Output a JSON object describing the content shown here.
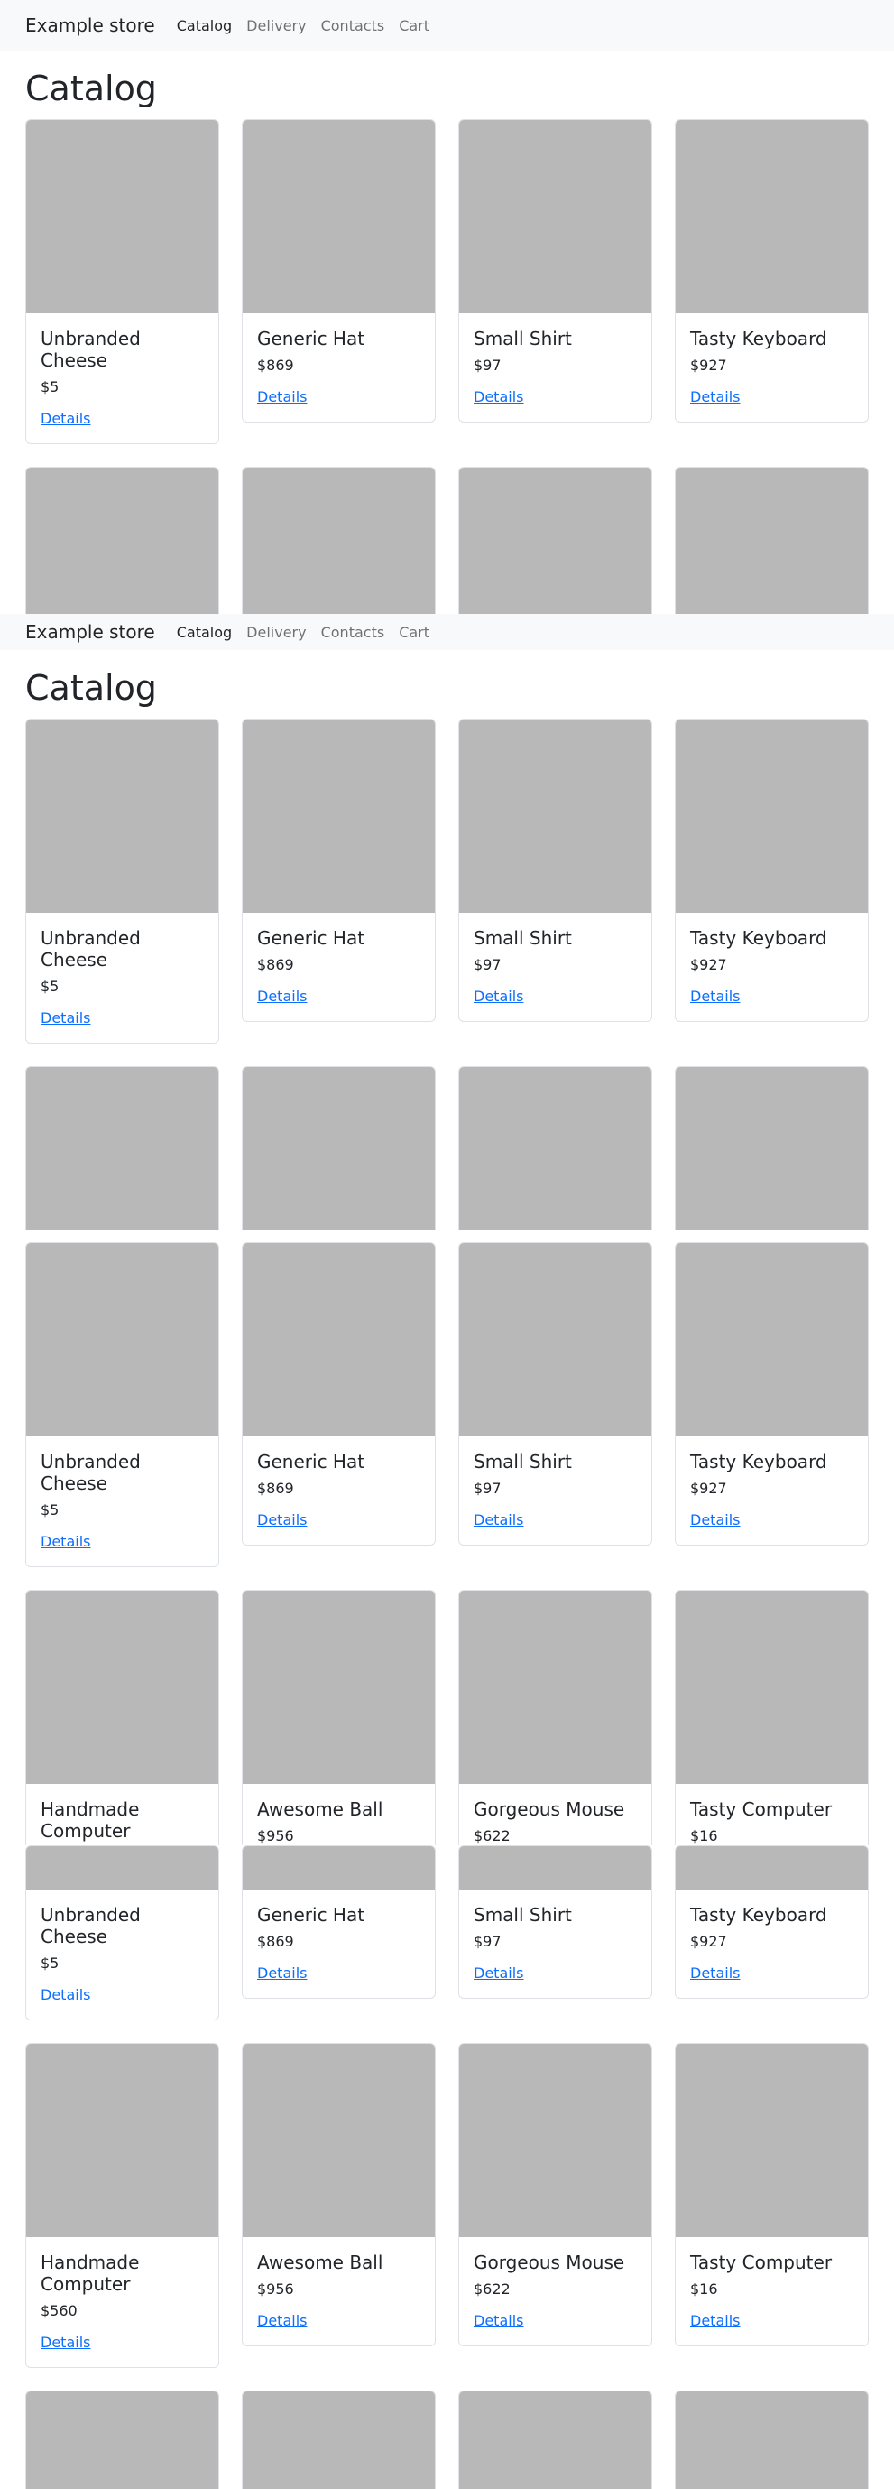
{
  "nav": {
    "brand": "Example store",
    "links": [
      {
        "label": "Catalog",
        "active": true
      },
      {
        "label": "Delivery"
      },
      {
        "label": "Contacts"
      },
      {
        "label": "Cart"
      }
    ]
  },
  "page_title": "Catalog",
  "details_label": "Details",
  "products": [
    {
      "name": "Unbranded Cheese",
      "price": "$5"
    },
    {
      "name": "Generic Hat",
      "price": "$869"
    },
    {
      "name": "Small Shirt",
      "price": "$97"
    },
    {
      "name": "Tasty Keyboard",
      "price": "$927"
    },
    {
      "name": "Handmade Computer",
      "price": "$560"
    },
    {
      "name": "Awesome Ball",
      "price": "$956"
    },
    {
      "name": "Gorgeous Mouse",
      "price": "$622"
    },
    {
      "name": "Tasty Computer",
      "price": "$16"
    }
  ],
  "colors": {
    "link": "#0d6efd",
    "placeholder": "#b8b8b8",
    "navbar": "#f8f9fa"
  }
}
